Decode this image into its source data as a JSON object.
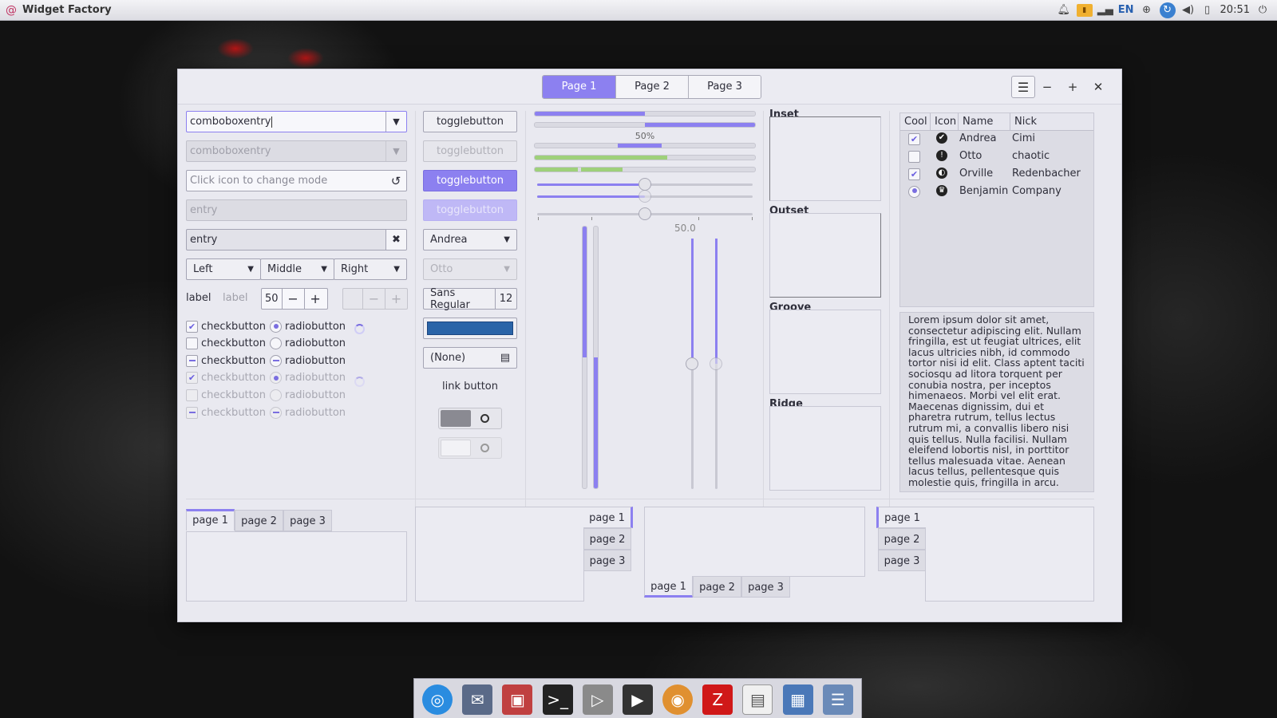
{
  "panel": {
    "app_title": "Widget Factory",
    "lang": "EN",
    "clock": "20:51",
    "tray_icons": [
      "bell-icon",
      "battery-icon",
      "signal-icon",
      "network-icon",
      "globe-icon",
      "volume-icon",
      "clipboard-icon",
      "power-icon"
    ]
  },
  "window": {
    "stack_tabs": [
      "Page 1",
      "Page 2",
      "Page 3"
    ],
    "menu_glyph": "☰",
    "min_glyph": "−",
    "max_glyph": "+",
    "close_glyph": "✕"
  },
  "col1": {
    "comboentry1": "comboboxentry",
    "comboentry2": "comboboxentry",
    "mode_placeholder": "Click icon to change mode",
    "entry_disabled": "entry",
    "entry_clear": "entry",
    "combos": [
      "Left",
      "Middle",
      "Right"
    ],
    "label1": "label",
    "label2": "label",
    "spin_value": "50",
    "checks": [
      {
        "label": "checkbutton",
        "state": "checked",
        "disabled": false
      },
      {
        "label": "checkbutton",
        "state": "off",
        "disabled": false
      },
      {
        "label": "checkbutton",
        "state": "mixed",
        "disabled": false
      },
      {
        "label": "checkbutton",
        "state": "checked",
        "disabled": true
      },
      {
        "label": "checkbutton",
        "state": "off",
        "disabled": true
      },
      {
        "label": "checkbutton",
        "state": "mixed",
        "disabled": true
      }
    ],
    "radios": [
      {
        "label": "radiobutton",
        "state": "on",
        "disabled": false
      },
      {
        "label": "radiobutton",
        "state": "off",
        "disabled": false
      },
      {
        "label": "radiobutton",
        "state": "mixed",
        "disabled": false
      },
      {
        "label": "radiobutton",
        "state": "on",
        "disabled": true
      },
      {
        "label": "radiobutton",
        "state": "off",
        "disabled": true
      },
      {
        "label": "radiobutton",
        "state": "mixed",
        "disabled": true
      }
    ]
  },
  "col2": {
    "toggles": [
      "togglebutton",
      "togglebutton",
      "togglebutton",
      "togglebutton"
    ],
    "combo_andrea": "Andrea",
    "combo_otto": "Otto",
    "font_name": "Sans Regular",
    "font_size": "12",
    "color_value": "#2a64a8",
    "file_none": "(None)",
    "link": "link button",
    "switch1_on": true,
    "switch2_on": false
  },
  "col3": {
    "progress_label": "50%",
    "scale_value_label": "50.0",
    "progress1": 0.5,
    "progress2": 0.5,
    "scale1": 0.5,
    "scale2": 0.5,
    "scale3": 0.5,
    "vprogress1": 0.5,
    "vprogress2": 0.5,
    "vscale1": 0.5,
    "vscale2": 0.5
  },
  "frames": [
    "Inset",
    "Outset",
    "Groove",
    "Ridge"
  ],
  "tree": {
    "columns": [
      "Cool",
      "Icon",
      "Name",
      "Nick"
    ],
    "rows": [
      {
        "cool": "checked",
        "icon": "✔",
        "name": "Andrea",
        "nick": "Cimi"
      },
      {
        "cool": "off",
        "icon": "!",
        "name": "Otto",
        "nick": "chaotic"
      },
      {
        "cool": "checked",
        "icon": "◐",
        "name": "Orville",
        "nick": "Redenbacher"
      },
      {
        "cool": "radio",
        "icon": "♛",
        "name": "Benjamin",
        "nick": "Company"
      }
    ]
  },
  "textview": "Lorem ipsum dolor sit amet, consectetur adipiscing elit. Nullam fringilla, est ut feugiat ultrices, elit lacus ultricies nibh, id commodo tortor nisi id elit. Class aptent taciti sociosqu ad litora torquent per conubia nostra, per inceptos himenaeos. Morbi vel elit erat. Maecenas dignissim, dui et pharetra rutrum, tellus lectus rutrum mi, a convallis libero nisi quis tellus. Nulla facilisi. Nullam eleifend lobortis nisl, in porttitor tellus malesuada vitae. Aenean lacus tellus, pellentesque quis molestie quis, fringilla in arcu.",
  "notebooks": [
    {
      "tabs": [
        "page 1",
        "page 2",
        "page 3"
      ]
    },
    {
      "tabs": [
        "page 1",
        "page 2",
        "page 3"
      ]
    },
    {
      "tabs": [
        "page 1",
        "page 2",
        "page 3"
      ]
    },
    {
      "tabs": [
        "page 1",
        "page 2",
        "page 3"
      ]
    }
  ],
  "dock": [
    "browser-icon",
    "mail-icon",
    "package-icon",
    "terminal-icon",
    "media-player-icon",
    "video-icon",
    "disc-icon",
    "filezilla-icon",
    "text-editor-icon",
    "window-manager-icon",
    "settings-icon"
  ],
  "colors": {
    "accent": "#8c80f0",
    "progress_green": "#9ed07a"
  }
}
